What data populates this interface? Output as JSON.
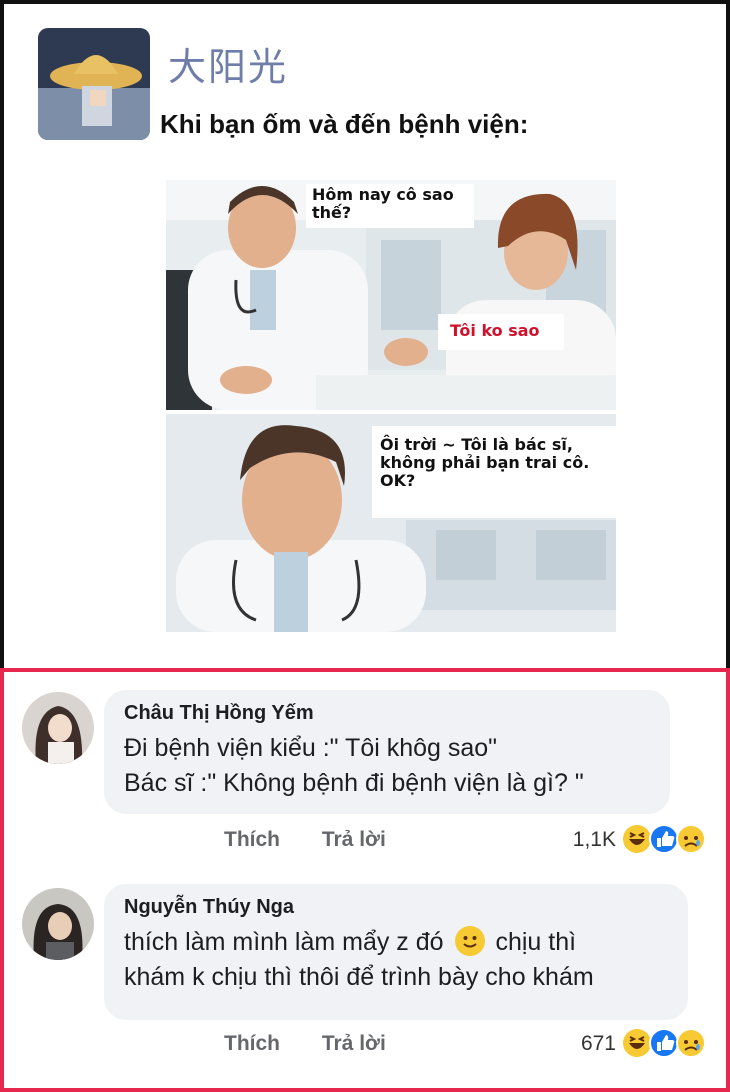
{
  "post": {
    "author": "大阳光",
    "caption": "Khi bạn ốm và đến bệnh viện:",
    "meme": {
      "bubble_1": "Hôm nay cô sao thế?",
      "bubble_2": "Tôi ko sao",
      "bubble_3": "Ôi trời ~ Tôi là bác sĩ, không phải bạn trai cô. OK?"
    }
  },
  "comments": [
    {
      "name": "Châu Thị Hồng Yếm",
      "line1": "Đi bệnh viện kiểu :\" Tôi khôg sao\"",
      "line2": "Bác sĩ :\" Không bệnh đi bệnh viện là gì? \"",
      "like": "Thích",
      "reply": "Trả lời",
      "reactions_count": "1,1K",
      "reactions": [
        "haha-icon",
        "like-icon",
        "sad-icon"
      ]
    },
    {
      "name": "Nguyễn Thúy Nga",
      "line1_a": "thích làm mình làm mẩy z đó",
      "line1_b": "chịu thì",
      "line2": "khám k chịu thì thôi để trình bày cho khám",
      "like": "Thích",
      "reply": "Trả lời",
      "reactions_count": "671",
      "reactions": [
        "haha-icon",
        "like-icon",
        "sad-icon"
      ]
    }
  ],
  "colors": {
    "highlight_border": "#e6284f",
    "comment_bubble": "#f0f2f5",
    "red_text": "#d0112b"
  }
}
